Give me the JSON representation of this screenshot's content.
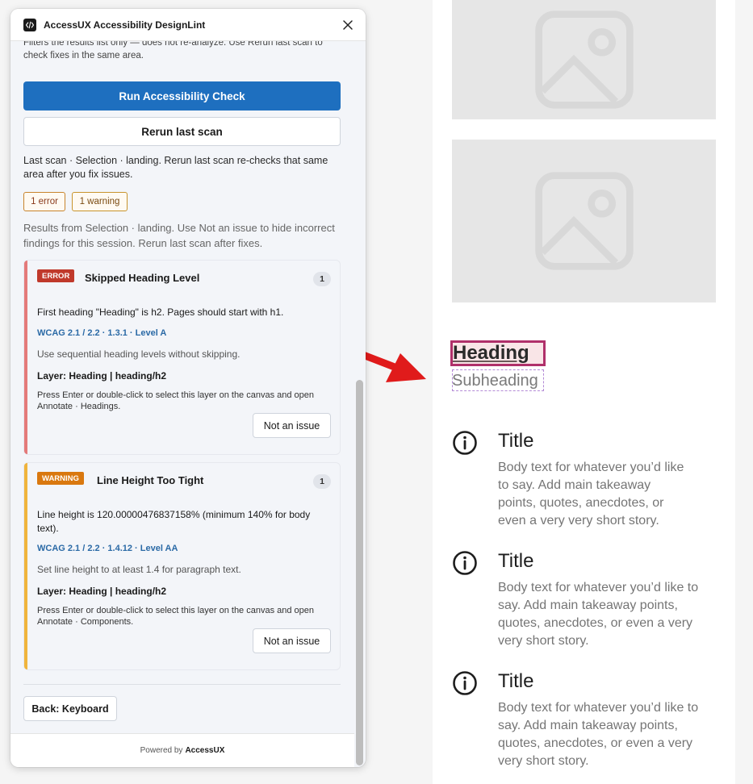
{
  "plugin": {
    "title": "AccessUX Accessibility DesignLint",
    "hint": "Filters the results list only — does not re-analyze. Use Rerun last scan to check fixes in the same area.",
    "run_button": "Run Accessibility Check",
    "rerun_button": "Rerun last scan",
    "last_scan": "Last scan · Selection · landing. Rerun last scan re-checks that same area after you fix issues.",
    "badges": {
      "errors": "1 error",
      "warnings": "1 warning"
    },
    "results_text": "Results from Selection · landing. Use Not an issue to hide incorrect findings for this session. Rerun last scan after fixes.",
    "issues": [
      {
        "severity": "ERROR",
        "severity_color": "#c0392b",
        "bar_color": "#e47a7a",
        "title": "Skipped Heading Level",
        "count": "1",
        "description": "First heading \"Heading\" is h2. Pages should start with h1.",
        "wcag": "WCAG 2.1 / 2.2 · 1.3.1 · Level A",
        "help": "Use sequential heading levels without skipping.",
        "layer": "Layer: Heading | heading/h2",
        "press": "Press Enter or double-click to select this layer on the canvas and open Annotate · Headings.",
        "action": "Not an issue"
      },
      {
        "severity": "WARNING",
        "severity_color": "#d9780f",
        "bar_color": "#f0b43c",
        "title": "Line Height Too Tight",
        "count": "1",
        "description": "Line height is 120.00000476837158% (minimum 140% for body text).",
        "wcag": "WCAG 2.1 / 2.2 · 1.4.12 · Level AA",
        "help": "Set line height to at least 1.4 for paragraph text.",
        "layer": "Layer: Heading | heading/h2",
        "press": "Press Enter or double-click to select this layer on the canvas and open Annotate · Components.",
        "action": "Not an issue"
      }
    ],
    "back_button": "Back: Keyboard",
    "footer_prefix": "Powered by",
    "footer_brand": "AccessUX"
  },
  "canvas": {
    "heading": "Heading",
    "subheading": "Subheading",
    "features": [
      {
        "icon": "info-icon",
        "title": "Title",
        "body": "Body text for whatever you’d like to say. Add main takeaway points, quotes, anecdotes, or even a very very short story."
      },
      {
        "icon": "info-icon",
        "title": "Title",
        "body": "Body text for whatever you’d like to say. Add main takeaway points, quotes, anecdotes, or even a very very short story."
      },
      {
        "icon": "info-icon",
        "title": "Title",
        "body": "Body text for whatever you’d like to say. Add main takeaway points, quotes, anecdotes, or even a very very short story."
      }
    ]
  },
  "colors": {
    "primary": "#1e6fbf",
    "error": "#c0392b",
    "warning": "#d9780f",
    "annotation_arrow": "#e01b1b",
    "selection": "#b0306a"
  }
}
